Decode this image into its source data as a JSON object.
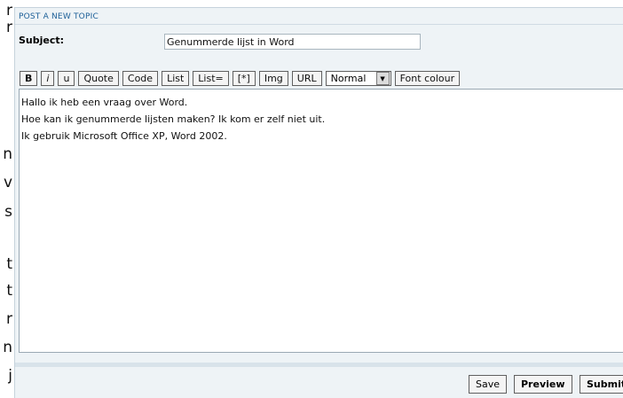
{
  "left_fragments": [
    "r",
    "r",
    "n",
    "v",
    "s",
    "t",
    "t",
    "r",
    "n",
    "j"
  ],
  "panel": {
    "title": "POST A NEW TOPIC"
  },
  "subject": {
    "label": "Subject:",
    "value": "Genummerde lijst in Word"
  },
  "toolbar": {
    "bold": "B",
    "italic": "i",
    "underline": "u",
    "quote": "Quote",
    "code": "Code",
    "list": "List",
    "list_eq": "List=",
    "list_item": "[*]",
    "img": "Img",
    "url": "URL",
    "size_select": "Normal",
    "font_colour": "Font colour"
  },
  "message": {
    "lines": [
      "Hallo ik heb een vraag over Word.",
      "Hoe kan ik genummerde lijsten maken? Ik kom er zelf niet uit.",
      "Ik gebruik Microsoft Office XP, Word 2002."
    ]
  },
  "actions": {
    "save": "Save",
    "preview": "Preview",
    "submit": "Submit"
  }
}
